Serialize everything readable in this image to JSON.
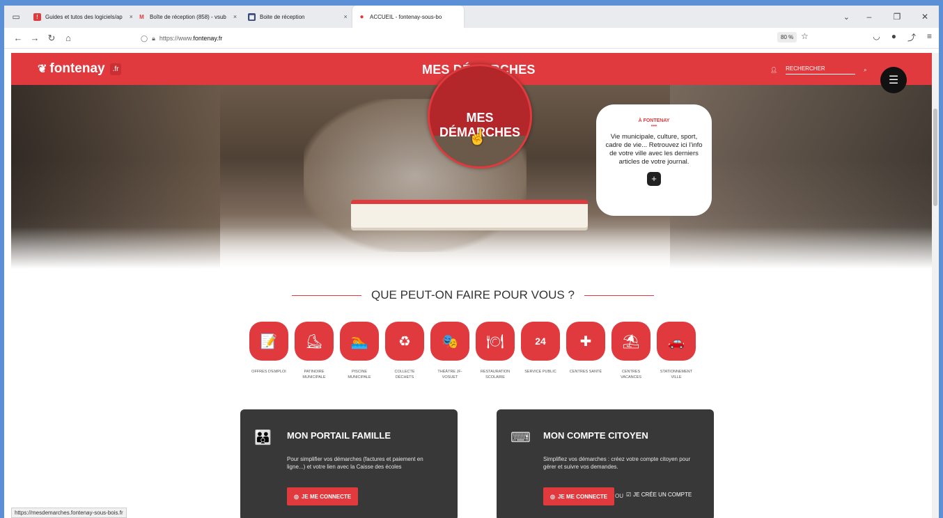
{
  "browser": {
    "tabs": [
      {
        "label": "Guides et tutos des logiciels/ap",
        "fav_color": "#e03a3e",
        "fav": "!"
      },
      {
        "label": "Boîte de réception (858) - vsub",
        "fav_color": "#ffffff",
        "fav": "M"
      },
      {
        "label": "Boite de réception",
        "fav_color": "#3a4a7c",
        "fav": "▦"
      },
      {
        "label": "ACCUEIL - fontenay-sous-bo",
        "fav_color": "#e03a3e",
        "fav": "●"
      }
    ],
    "tab_close": "×",
    "url_prefix": "https://www.",
    "url_domain": "fontenay.fr",
    "zoom": "80 %",
    "status_url": "https://mesdemarches.fontenay-sous-bois.fr"
  },
  "site": {
    "logo_text": "fontenay",
    "logo_tld": ".fr",
    "header_title": "MES DÉMARCHES",
    "search_label": "RECHERCHER",
    "hero_card": {
      "tag": "À FONTENAY",
      "dots": "•••",
      "text": "Vie municipale, culture, sport, cadre de vie... Retrouvez ici l'info de votre ville avec les derniers articles de votre journal.",
      "plus": "+"
    },
    "section_title": "QUE PEUT-ON FAIRE POUR VOUS ?",
    "services": [
      {
        "label": "OFFRES D'EMPLOI",
        "icon": "📝"
      },
      {
        "label": "PATINOIRE MUNICIPALE",
        "icon": "⛸"
      },
      {
        "label": "PISCINE MUNICIPALE",
        "icon": "🏊"
      },
      {
        "label": "COLLECTE DÉCHETS",
        "icon": "♻"
      },
      {
        "label": "THÉÂTRE JF-VOSUET",
        "icon": "🎭"
      },
      {
        "label": "RESTAURATION SCOLAIRE",
        "icon": "🍽"
      },
      {
        "label": "SERVICE PUBLIC",
        "icon": "24"
      },
      {
        "label": "CENTRES SANTÉ",
        "icon": "✚"
      },
      {
        "label": "CENTRES VACANCES",
        "icon": "⛱"
      },
      {
        "label": "STATIONNEMENT VILLE",
        "icon": "🚗"
      }
    ],
    "panels": {
      "family": {
        "title": "MON PORTAIL FAMILLE",
        "text": "Pour simplifier vos démarches (factures et paiement en ligne...) et votre lien avec la Caisse des écoles",
        "button": "JE ME CONNECTE"
      },
      "citizen": {
        "title": "MON COMPTE CITOYEN",
        "text": "Simplifiez vos démarches : créez votre compte citoyen pour gérer et suivre vos demandes.",
        "button": "JE ME CONNECTE",
        "or": "OU",
        "link": "JE CRÉE UN COMPTE"
      }
    }
  },
  "colors": {
    "brand_red": "#e03a3e",
    "panel_dark": "#383838"
  }
}
